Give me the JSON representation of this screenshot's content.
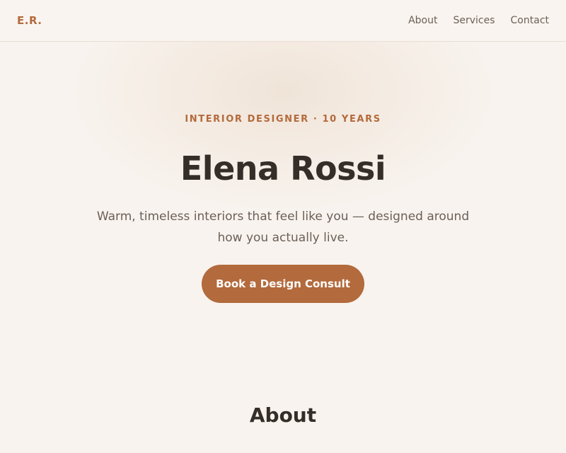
{
  "nav": {
    "logo": "E.R.",
    "links": [
      {
        "label": "About"
      },
      {
        "label": "Services"
      },
      {
        "label": "Contact"
      }
    ]
  },
  "hero": {
    "eyebrow": "INTERIOR DESIGNER · 10 YEARS",
    "title": "Elena Rossi",
    "subtitle": "Warm, timeless interiors that feel like you — designed around how you actually live.",
    "cta_label": "Book a Design Consult"
  },
  "about": {
    "heading": "About"
  },
  "colors": {
    "accent": "#b36a3c",
    "background": "#f8f3ee",
    "text": "#342d28",
    "muted": "#6b5f58"
  }
}
